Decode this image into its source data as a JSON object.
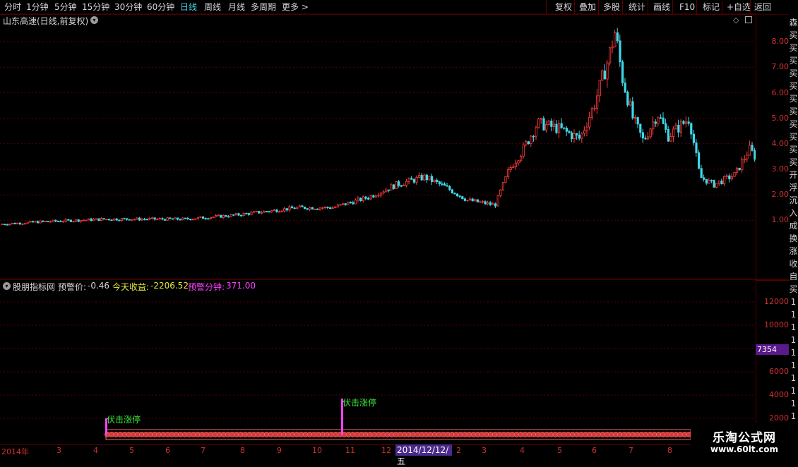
{
  "toolbar": {
    "periods": [
      "分时",
      "1分钟",
      "5分钟",
      "15分钟",
      "30分钟",
      "60分钟",
      "日线",
      "周线",
      "月线",
      "多周期",
      "更多 >"
    ],
    "active_period": "日线",
    "tools": [
      "复权",
      "叠加",
      "多股",
      "统计",
      "画线",
      "F10",
      "标记",
      "+自选",
      "返回"
    ]
  },
  "main_chart": {
    "title": "山东高速(日线,前复权)",
    "price_axis": [
      "8.00",
      "7.00",
      "6.00",
      "5.00",
      "4.00",
      "3.00",
      "2.00",
      "1.00"
    ]
  },
  "indicator": {
    "name": "股朋指标网",
    "warn_price_label": "预警价:",
    "warn_price_value": "-0.46",
    "today_income_label": "今天收益:",
    "today_income_value": "-2206.52",
    "warn_minute_label": "预警分钟:",
    "warn_minute_value": "371.00",
    "axis": [
      "12000",
      "10000",
      "8000",
      "6000",
      "4000",
      "2000"
    ],
    "current_marker": "7354",
    "signal_text": "伏击涨停",
    "signal_text_2": "伏击涨停"
  },
  "date_axis": {
    "labels": [
      "2014年",
      "3",
      "4",
      "5",
      "6",
      "7",
      "8",
      "9",
      "10",
      "11",
      "12",
      "2",
      "3",
      "4",
      "5",
      "6",
      "7",
      "8"
    ],
    "highlight": "2014/12/12/五"
  },
  "sidebar_chars": [
    "森",
    "买",
    "买",
    "买",
    "买",
    "买",
    "买",
    "买",
    "买",
    "买",
    "买",
    "买",
    "开",
    "浮",
    "沉",
    "入",
    "成",
    "换",
    "涨",
    "收",
    "自",
    "买",
    "1",
    "1",
    "1",
    "1",
    "1",
    "1",
    "1",
    "1",
    "1",
    "1"
  ],
  "watermark": {
    "title": "乐淘公式网",
    "url": "www.60lt.com"
  },
  "colors": {
    "up": "#ff3c3c",
    "down": "#3fd8e8",
    "grid": "#5a0000",
    "accent": "#d23030",
    "magenta": "#ff40ff"
  }
}
